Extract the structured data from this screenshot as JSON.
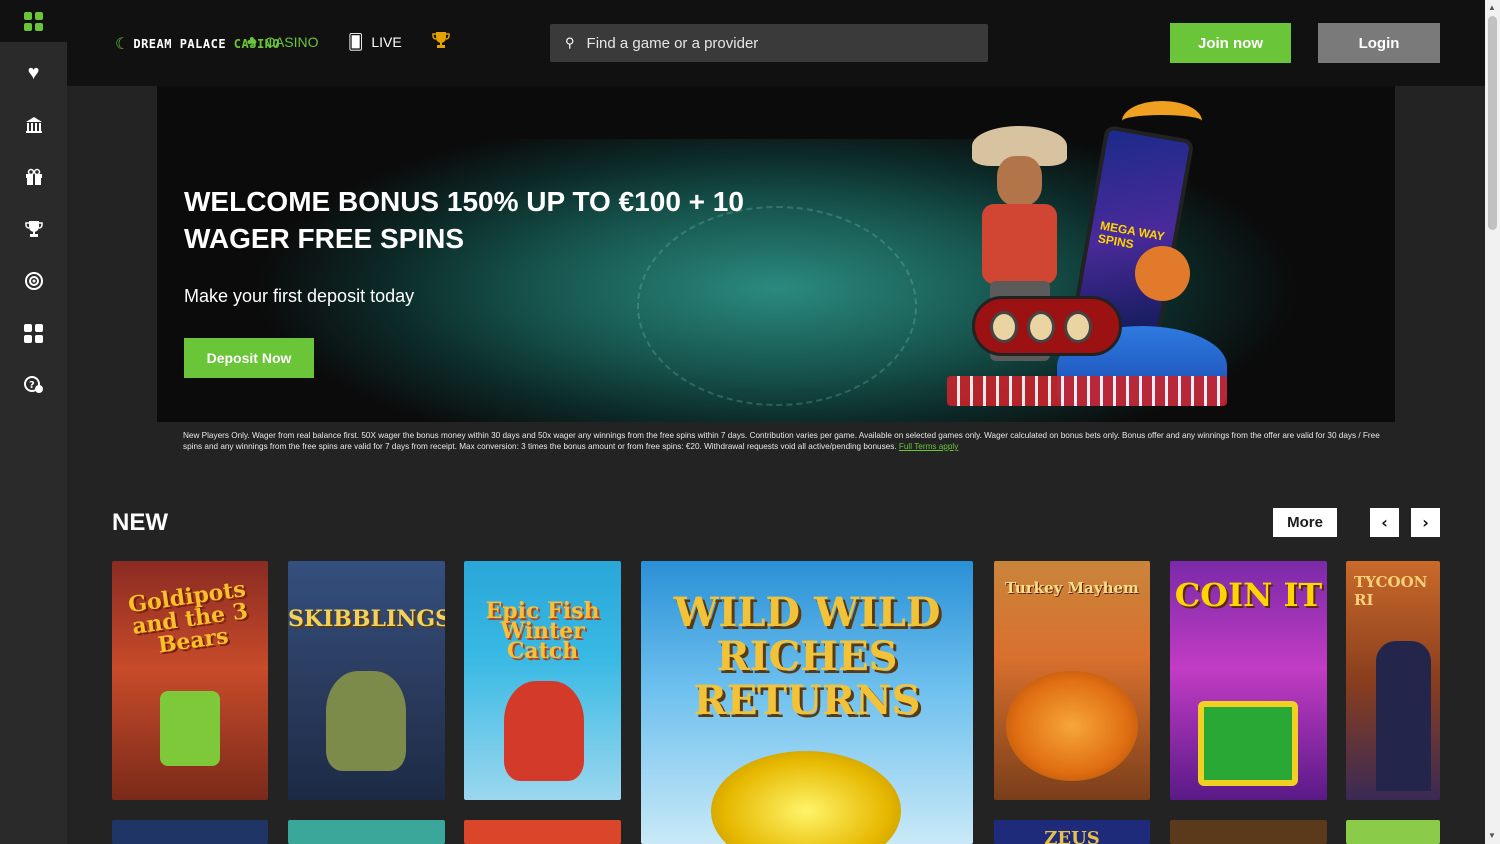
{
  "sidebar": {
    "icons": [
      "menu-grid-icon",
      "heart-icon",
      "casino-building-icon",
      "gift-icon",
      "trophy-icon",
      "target-icon",
      "dashboard-icon",
      "support-chat-icon"
    ]
  },
  "header": {
    "logo_text_main": "DREAM PALACE",
    "logo_text_accent": "CASINO",
    "nav": {
      "casino": "CASINO",
      "live": "LIVE"
    },
    "search_placeholder": "Find a game or a provider",
    "join_label": "Join now",
    "login_label": "Login",
    "accent_color": "#6ac539"
  },
  "hero": {
    "title": "WELCOME BONUS 150% UP TO €100 + 10 WAGER FREE SPINS",
    "subtitle": "Make your first deposit today",
    "cta": "Deposit Now",
    "phone_text": "MEGA WAY SPINS"
  },
  "terms": {
    "text": "New Players Only. Wager from real balance first. 50X wager the bonus money within 30 days and 50x wager any winnings from the free spins within 7 days. Contribution varies per game. Available on selected games only. Wager calculated on bonus bets only. Bonus offer and any winnings from the offer are valid for 30 days / Free spins and any winnings from the free spins are valid for 7 days from receipt. Max conversion: 3 times the bonus amount or from free spins: €20. Withdrawal requests void all active/pending bonuses.",
    "link": "Full Terms apply"
  },
  "new_section": {
    "title": "NEW",
    "more_label": "More",
    "prev": "‹",
    "next": "›",
    "games": [
      {
        "name": "Goldipots and the 3 Bears"
      },
      {
        "name": "SKIBBLINGS"
      },
      {
        "name": "Epic Fish Winter Catch"
      },
      {
        "name": "WILD WILD RICHES RETURNS"
      },
      {
        "name": "Turkey Mayhem"
      },
      {
        "name": "COIN IT"
      },
      {
        "name": "TYCOON RI"
      }
    ],
    "row2": [
      {
        "name": ""
      },
      {
        "name": ""
      },
      {
        "name": ""
      },
      {
        "name": "ZEUS"
      },
      {
        "name": ""
      },
      {
        "name": ""
      }
    ]
  }
}
